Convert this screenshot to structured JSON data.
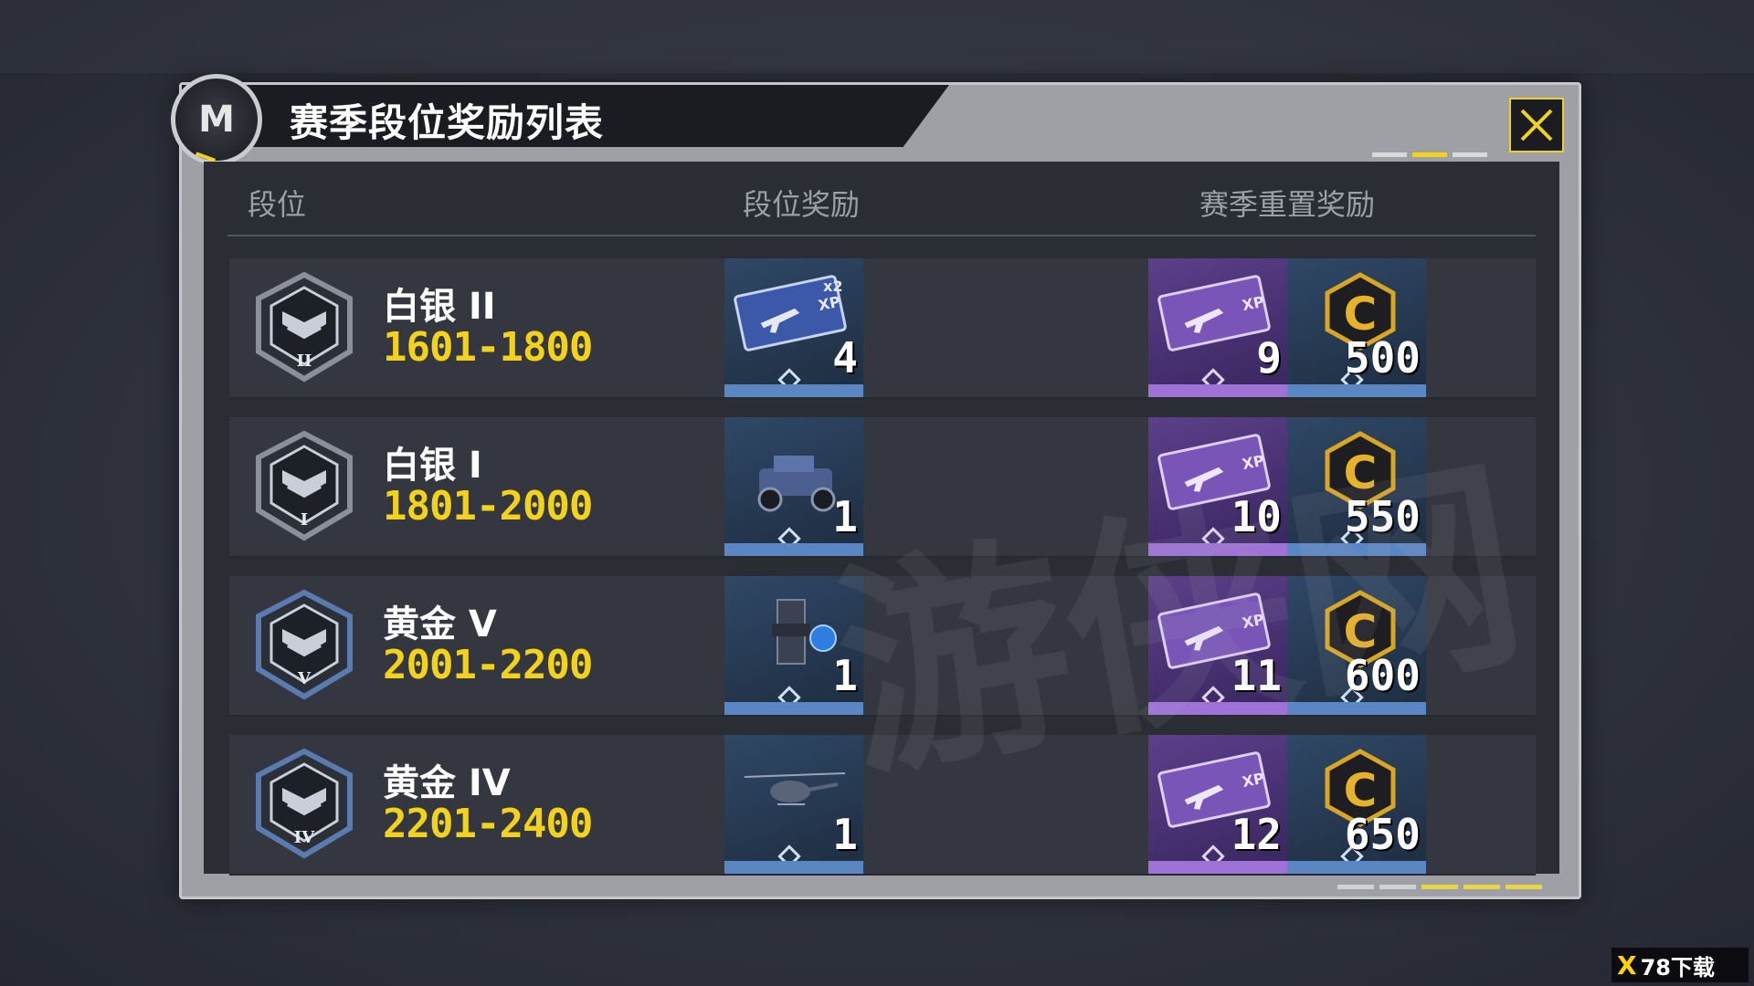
{
  "modal": {
    "title": "赛季段位奖励列表",
    "emblem_glyph": "M",
    "close_icon": "close-icon",
    "accent_color": "#f2d21a"
  },
  "columns": {
    "rank": "段位",
    "rank_reward": "段位奖励",
    "season_reset_reward": "赛季重置奖励"
  },
  "rows": [
    {
      "rank_name": "白银 II",
      "rank_range": "1601-1800",
      "badge_numeral": "II",
      "badge_color": "#8a9099",
      "rank_reward": {
        "icon": "xp-card-x2-icon",
        "count": "4",
        "tile_color": "blue"
      },
      "reset_rewards": [
        {
          "icon": "weapon-xp-card-icon",
          "count": "9",
          "tile_color": "purple"
        },
        {
          "icon": "cod-credits-icon",
          "count": "500",
          "tile_color": "blue"
        }
      ]
    },
    {
      "rank_name": "白银 I",
      "rank_range": "1801-2000",
      "badge_numeral": "I",
      "badge_color": "#8a9099",
      "rank_reward": {
        "icon": "vehicle-skin-icon",
        "count": "1",
        "tile_color": "blue"
      },
      "reset_rewards": [
        {
          "icon": "weapon-xp-card-icon",
          "count": "10",
          "tile_color": "purple"
        },
        {
          "icon": "cod-credits-icon",
          "count": "550",
          "tile_color": "blue"
        }
      ]
    },
    {
      "rank_name": "黄金 V",
      "rank_range": "2001-2200",
      "badge_numeral": "V",
      "badge_color": "#5a7bb0",
      "rank_reward": {
        "icon": "backpack-item-icon",
        "count": "1",
        "tile_color": "blue"
      },
      "reset_rewards": [
        {
          "icon": "weapon-xp-card-icon",
          "count": "11",
          "tile_color": "purple"
        },
        {
          "icon": "cod-credits-icon",
          "count": "600",
          "tile_color": "blue"
        }
      ]
    },
    {
      "rank_name": "黄金 IV",
      "rank_range": "2201-2400",
      "badge_numeral": "IV",
      "badge_color": "#5a7bb0",
      "rank_reward": {
        "icon": "helicopter-skin-icon",
        "count": "1",
        "tile_color": "blue"
      },
      "reset_rewards": [
        {
          "icon": "weapon-xp-card-icon",
          "count": "12",
          "tile_color": "purple"
        },
        {
          "icon": "cod-credits-icon",
          "count": "650",
          "tile_color": "blue"
        }
      ]
    }
  ],
  "watermark_text": "游侠网",
  "site_logo": {
    "mark": "X",
    "text": "78下载"
  }
}
